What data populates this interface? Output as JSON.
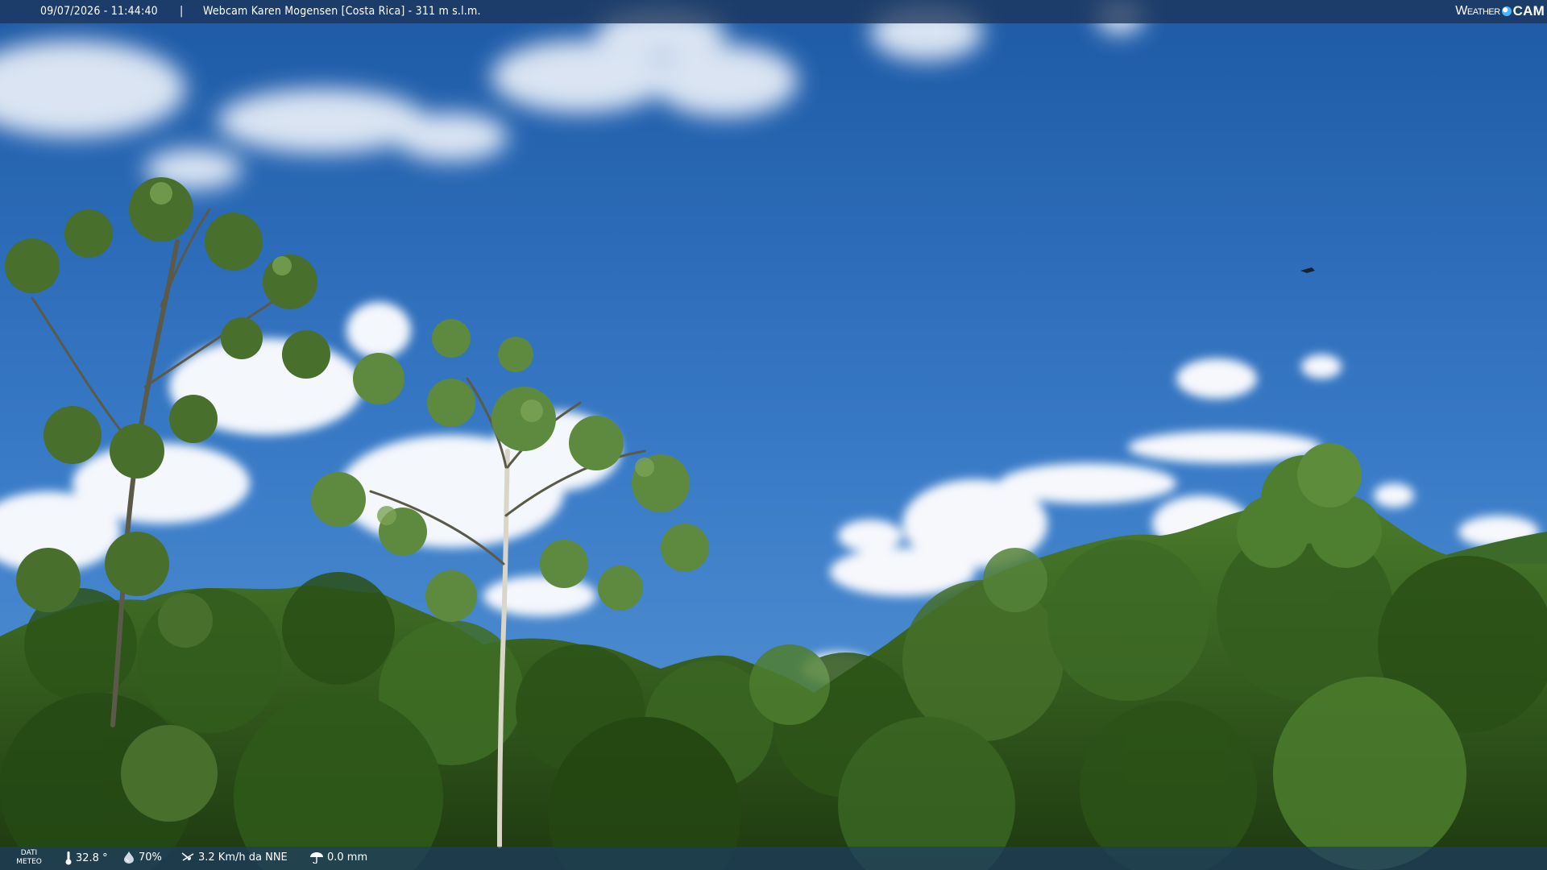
{
  "header": {
    "timestamp": "09/07/2026 - 11:44:40",
    "separator": "|",
    "title": "Webcam Karen Mogensen [Costa Rica] - 311 m s.l.m.",
    "logo": {
      "word1": "Weather",
      "word2": "CAM"
    }
  },
  "footer": {
    "dati_line1": "DATI",
    "dati_line2": "METEO",
    "temperature": "32.8 °",
    "humidity": "70%",
    "wind": "3.2 Km/h da NNE",
    "rain": "0.0 mm",
    "icons": [
      "thermometer-icon",
      "humidity-drop-icon",
      "wind-icon",
      "rain-gauge-icon"
    ]
  },
  "colors": {
    "sky_top": "#1f5ea8",
    "sky_bottom": "#4f8fd0",
    "foliage_dark": "#1f3d12",
    "foliage_mid": "#3c6b22",
    "foliage_light": "#6c9a3f",
    "bar_bg": "#1c345a",
    "logo_accent": "#47b6ff"
  }
}
